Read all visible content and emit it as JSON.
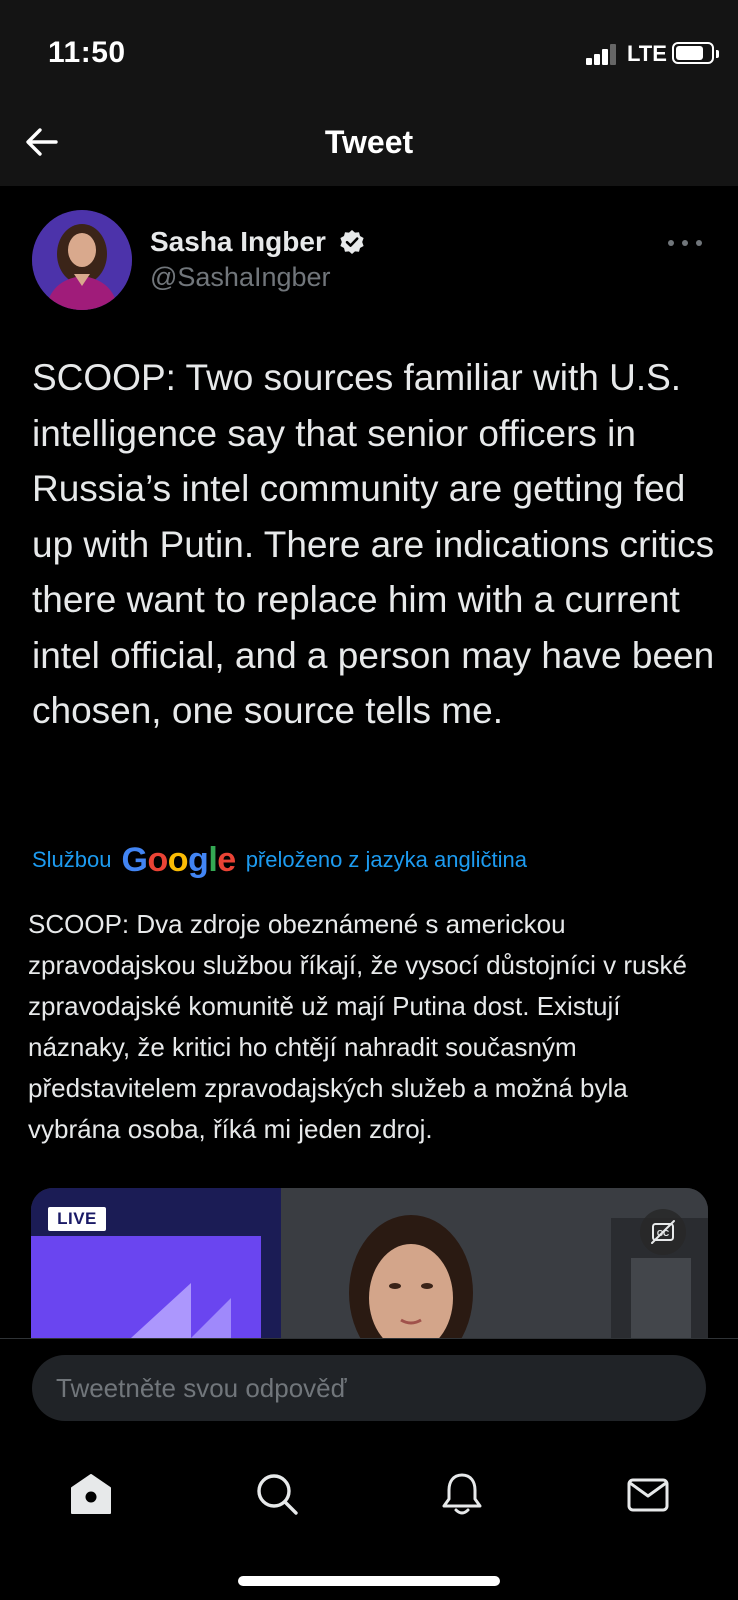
{
  "status_bar": {
    "time": "11:50",
    "network": "LTE"
  },
  "header": {
    "title": "Tweet",
    "back_icon": "arrow-left-icon"
  },
  "tweet": {
    "author_name": "Sasha Ingber",
    "author_handle": "@SashaIngber",
    "verified": true,
    "text": "SCOOP: Two sources familiar with U.S. intelligence say that senior officers in Russia’s intel community are getting fed up with Putin. There are indications critics there want to replace him with a current intel official, and a person may have been chosen, one source tells me.",
    "translation": {
      "prefix": "Službou",
      "provider": "Google",
      "suffix": "přeloženo z jazyka angličtina",
      "text": "SCOOP: Dva zdroje obeznámené s americkou zpravodajskou službou říkají, že vysocí důstojníci v ruské zpravodajské komunitě už mají Putina dost. Existují náznaky, že kritici ho chtějí nahradit současným představitelem zpravodajských služeb a možná byla vybrána osoba, říká mi jeden zdroj."
    },
    "media": {
      "badge": "LIVE",
      "cc_icon": "closed-captions-off-icon"
    }
  },
  "reply": {
    "placeholder": "Tweetněte svou odpověď"
  },
  "tab_bar": {
    "items": [
      "home-icon",
      "search-icon",
      "notifications-icon",
      "messages-icon"
    ]
  },
  "colors": {
    "background": "#000000",
    "header_background": "#141414",
    "text_primary": "#e7e9ea",
    "text_secondary": "#71767b",
    "accent": "#1d9bf0",
    "google_blue": "#4285F4",
    "google_red": "#EA4335",
    "google_yellow": "#FBBC05",
    "google_green": "#34A853"
  }
}
